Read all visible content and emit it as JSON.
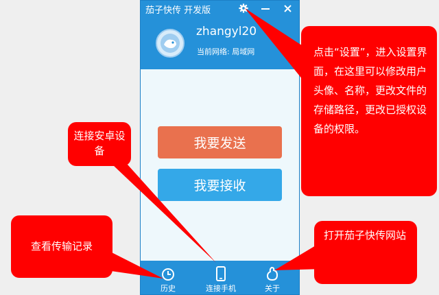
{
  "window": {
    "title": "茄子快传 开发版",
    "minimize_glyph": "—",
    "close_glyph": "✕"
  },
  "user": {
    "name": "zhangyl20",
    "network_label": "当前网络: 局域网"
  },
  "actions": {
    "send_label": "我要发送",
    "receive_label": "我要接收"
  },
  "bottom_nav": {
    "history_label": "历史",
    "connect_label": "连接手机",
    "about_label": "关于"
  },
  "callouts": {
    "settings": "点击“设置”，进入设置界面，在这里可以修改用户头像、名称，更改文件的存储路径，更改已授权设备的权限。",
    "connect": "连接安卓设备",
    "history": "查看传输记录",
    "website": "打开茄子快传网站"
  },
  "colors": {
    "primary": "#2591d9",
    "send": "#e9714e",
    "receive": "#34a8e8",
    "callout": "#ff0000",
    "content_bg": "#eef8fc"
  },
  "icons": [
    "gear-icon",
    "minimize-icon",
    "close-icon",
    "avatar",
    "clock-icon",
    "phone-icon",
    "about-icon"
  ]
}
